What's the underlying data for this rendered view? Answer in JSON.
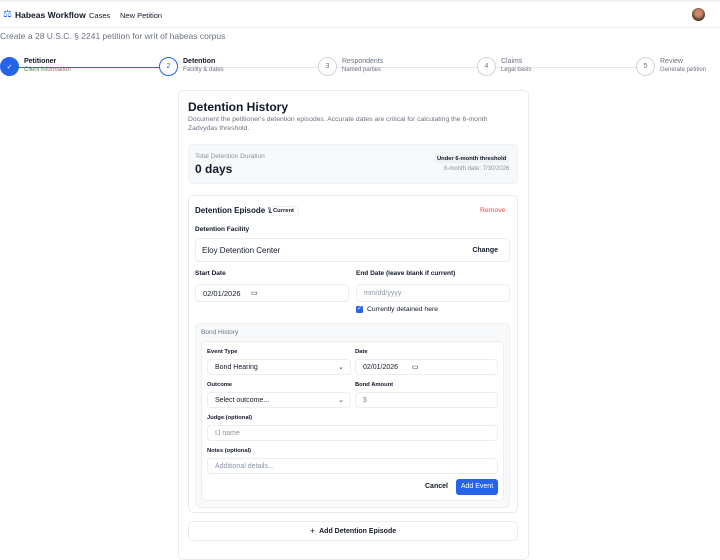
{
  "header": {
    "brand": "Habeas Workflow",
    "nav": [
      "Cases",
      "New Petition"
    ]
  },
  "subtitle": "Create a 28 U.S.C. § 2241 petition for writ of habeas corpus",
  "steps": [
    {
      "num": "✓",
      "title": "Petitioner",
      "sub": "Client information",
      "state": "complete"
    },
    {
      "num": "2",
      "title": "Detention",
      "sub": "Facility & dates",
      "state": "active"
    },
    {
      "num": "3",
      "title": "Respondents",
      "sub": "Named parties",
      "state": "pending"
    },
    {
      "num": "4",
      "title": "Claims",
      "sub": "Legal basis",
      "state": "pending"
    },
    {
      "num": "5",
      "title": "Review",
      "sub": "Generate petition",
      "state": "pending"
    }
  ],
  "card": {
    "title": "Detention History",
    "desc1": "Document the petitioner's detention episodes. Accurate dates are critical for calculating the 6-month",
    "desc2": "Zadvydas threshold."
  },
  "summary": {
    "label": "Total Detention Duration",
    "value": "0 days",
    "badge": "Under 6-month threshold",
    "date": "6-month date: 7/30/2026"
  },
  "episode": {
    "title": "Detention Episode 1",
    "badge": "Current",
    "remove": "Remove",
    "facility_label": "Detention Facility",
    "facility": "Eloy Detention Center",
    "change": "Change",
    "start_label": "Start Date",
    "start_value": "02/01/2026",
    "end_label": "End Date (leave blank if current)",
    "end_placeholder": "mm/dd/yyyy",
    "current_label": "Currently detained here",
    "current_checked": true
  },
  "bond": {
    "title": "Bond History",
    "event_type_label": "Event Type",
    "event_type": "Bond Hearing",
    "date_label": "Date",
    "date": "02/01/2026",
    "outcome_label": "Outcome",
    "outcome": "Select outcome...",
    "amount_label": "Bond Amount",
    "amount_placeholder": "$",
    "judge_label": "Judge (optional)",
    "judge_placeholder": "IJ name",
    "notes_label": "Notes (optional)",
    "notes_placeholder": "Additional details...",
    "cancel": "Cancel",
    "add": "Add Event"
  },
  "add_episode": "Add Detention Episode",
  "colors": {
    "accent": "#2563eb",
    "danger": "#ef4444"
  }
}
